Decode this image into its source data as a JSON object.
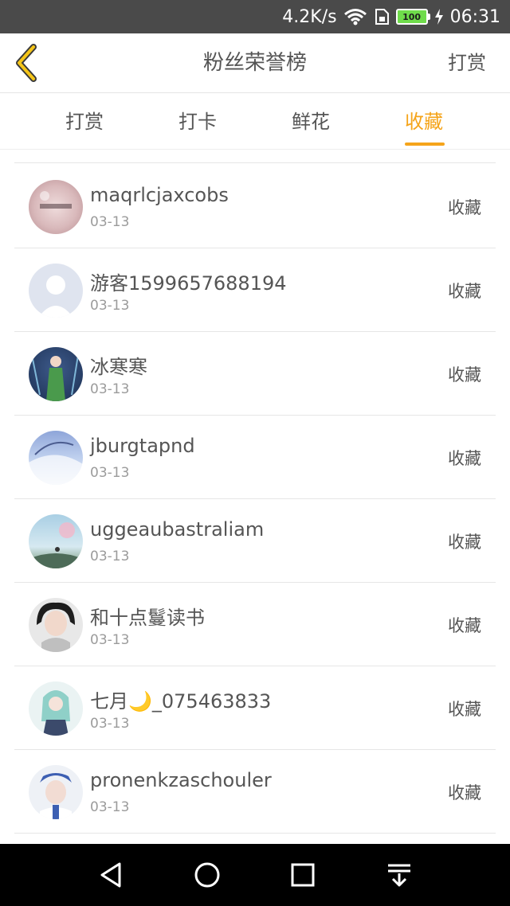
{
  "status_bar": {
    "speed": "4.2K/s",
    "battery": "100",
    "time": "06:31"
  },
  "header": {
    "title": "粉丝荣誉榜",
    "right_action": "打赏"
  },
  "tabs": [
    {
      "label": "打赏",
      "active": false
    },
    {
      "label": "打卡",
      "active": false
    },
    {
      "label": "鲜花",
      "active": false
    },
    {
      "label": "收藏",
      "active": true
    }
  ],
  "accent_color": "#f5a41a",
  "fans": [
    {
      "name": "maqrlcjaxcobs",
      "date": "03-13",
      "action": "收藏"
    },
    {
      "name": "游客1599657688194",
      "date": "03-13",
      "action": "收藏"
    },
    {
      "name": "冰寒寒",
      "date": "03-13",
      "action": "收藏"
    },
    {
      "name": "jburgtapnd",
      "date": "03-13",
      "action": "收藏"
    },
    {
      "name": "uggeaubastraliam",
      "date": "03-13",
      "action": "收藏"
    },
    {
      "name": "和十点鬘读书",
      "date": "03-13",
      "action": "收藏"
    },
    {
      "name": "七月🌙_075463833",
      "date": "03-13",
      "action": "收藏"
    },
    {
      "name": "pronenkzaschouler",
      "date": "03-13",
      "action": "收藏"
    }
  ],
  "nav_bar": {
    "icons": [
      "back-icon",
      "home-icon",
      "recents-icon",
      "notification-pulldown-icon"
    ]
  }
}
